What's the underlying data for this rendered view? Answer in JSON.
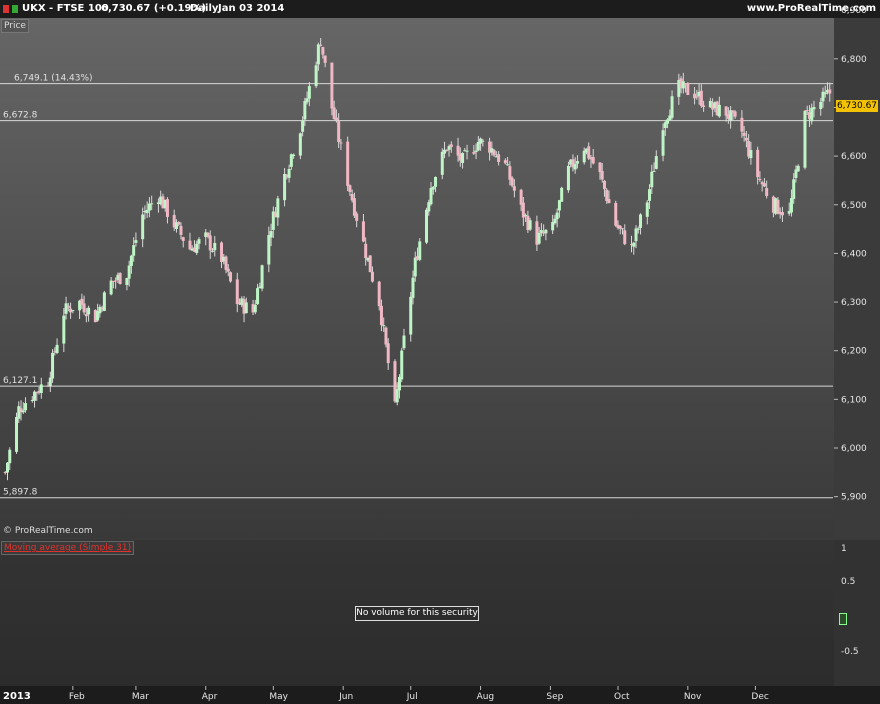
{
  "header": {
    "symbol": "UKX - FTSE 100",
    "price": "6,730.67 (+0.19%)",
    "period": "Daily",
    "date": "Jan 03 2014",
    "brand": "www.ProRealTime.com"
  },
  "panels": {
    "price_label": "Price",
    "copyright": "© ProRealTime.com",
    "indicator_label": "Moving average (Simple 31)",
    "no_volume": "No volume for this security",
    "last_price": "6,730.67"
  },
  "colors": {
    "up": "#bff5c6",
    "down": "#f0b8c4",
    "wick": "#d9d9d9",
    "last_price_bg": "#f2c200",
    "indicator_label": "#e0322d"
  },
  "chart_data": {
    "type": "candlestick",
    "y_range": [
      5840,
      6940
    ],
    "y_ticks": [
      "5,900",
      "6,000",
      "6,100",
      "6,200",
      "6,300",
      "6,400",
      "6,500",
      "6,600",
      "6,700",
      "6,800",
      "6,900"
    ],
    "x_labels": [
      "2013",
      "Feb",
      "Mar",
      "Apr",
      "May",
      "Jun",
      "Jul",
      "Aug",
      "Sep",
      "Oct",
      "Nov",
      "Dec"
    ],
    "annotations": [
      {
        "value": 6749.1,
        "text": "6,749.1 (14.43%)"
      },
      {
        "value": 6672.8,
        "text": "6,672.8"
      },
      {
        "value": 6127.1,
        "text": "6,127.1"
      },
      {
        "value": 5897.8,
        "text": "5,897.8"
      }
    ],
    "lower_ticks": [
      "1",
      "0.5",
      "0",
      "-0.5"
    ],
    "close_anchors": [
      [
        "2013-01-02",
        5950
      ],
      [
        "2013-01-08",
        6080
      ],
      [
        "2013-01-14",
        6110
      ],
      [
        "2013-01-21",
        6140
      ],
      [
        "2013-01-28",
        6280
      ],
      [
        "2013-02-04",
        6300
      ],
      [
        "2013-02-11",
        6270
      ],
      [
        "2013-02-18",
        6340
      ],
      [
        "2013-02-25",
        6360
      ],
      [
        "2013-03-04",
        6480
      ],
      [
        "2013-03-11",
        6520
      ],
      [
        "2013-03-18",
        6460
      ],
      [
        "2013-03-25",
        6410
      ],
      [
        "2013-04-01",
        6430
      ],
      [
        "2013-04-08",
        6390
      ],
      [
        "2013-04-15",
        6300
      ],
      [
        "2013-04-22",
        6280
      ],
      [
        "2013-04-29",
        6440
      ],
      [
        "2013-05-06",
        6560
      ],
      [
        "2013-05-13",
        6660
      ],
      [
        "2013-05-22",
        6840
      ],
      [
        "2013-05-27",
        6700
      ],
      [
        "2013-06-03",
        6550
      ],
      [
        "2013-06-10",
        6420
      ],
      [
        "2013-06-17",
        6300
      ],
      [
        "2013-06-24",
        6080
      ],
      [
        "2013-06-28",
        6220
      ],
      [
        "2013-07-03",
        6380
      ],
      [
        "2013-07-10",
        6540
      ],
      [
        "2013-07-17",
        6620
      ],
      [
        "2013-07-24",
        6590
      ],
      [
        "2013-07-31",
        6630
      ],
      [
        "2013-08-05",
        6620
      ],
      [
        "2013-08-12",
        6580
      ],
      [
        "2013-08-19",
        6490
      ],
      [
        "2013-08-26",
        6430
      ],
      [
        "2013-09-02",
        6450
      ],
      [
        "2013-09-09",
        6570
      ],
      [
        "2013-09-16",
        6620
      ],
      [
        "2013-09-23",
        6560
      ],
      [
        "2013-09-30",
        6460
      ],
      [
        "2013-10-07",
        6410
      ],
      [
        "2013-10-14",
        6510
      ],
      [
        "2013-10-21",
        6670
      ],
      [
        "2013-10-28",
        6740
      ],
      [
        "2013-11-04",
        6730
      ],
      [
        "2013-11-11",
        6700
      ],
      [
        "2013-11-18",
        6690
      ],
      [
        "2013-11-25",
        6650
      ],
      [
        "2013-12-02",
        6560
      ],
      [
        "2013-12-09",
        6500
      ],
      [
        "2013-12-16",
        6480
      ],
      [
        "2013-12-23",
        6680
      ],
      [
        "2014-01-03",
        6730
      ]
    ]
  }
}
